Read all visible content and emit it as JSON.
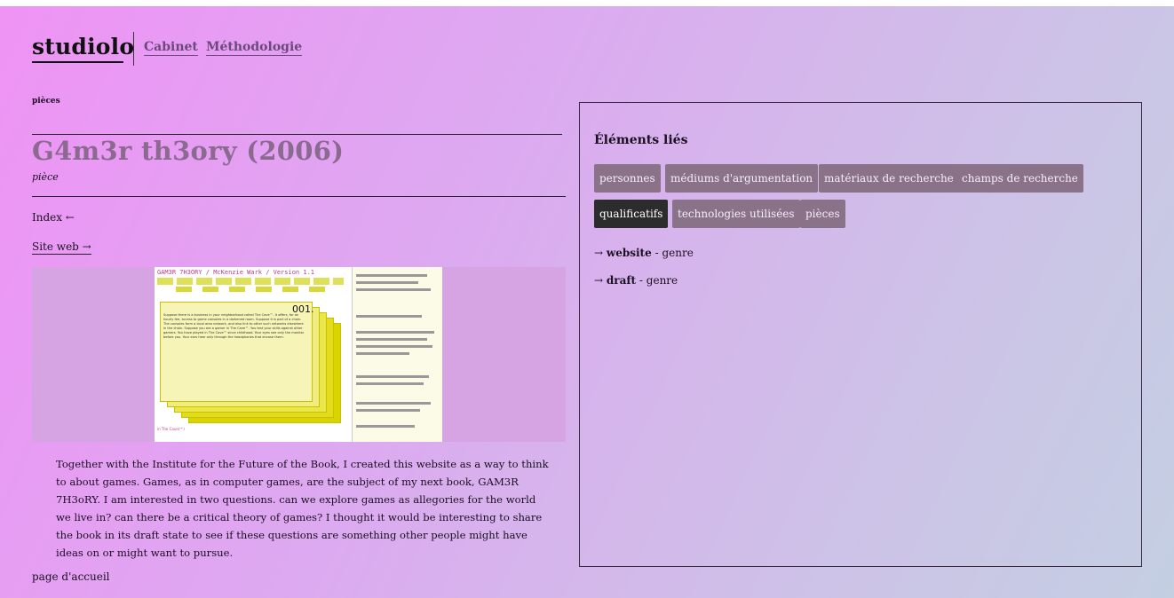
{
  "site": {
    "brand": "studiolo",
    "nav": [
      {
        "label": "Cabinet"
      },
      {
        "label": "Méthodologie"
      }
    ]
  },
  "page": {
    "breadcrumb": "pièces",
    "title": "G4m3r th3ory (2006)",
    "subtitle": "pièce",
    "index_link": "Index ←",
    "site_link": "Site web →",
    "description": "Together with the Institute for the Future of the Book, I created this website as a way to think to about games. Games, as in computer games, are the subject of my next book, GAM3R 7H3oRY. I am interested in two questions. can we explore games as allegories for the world we live in? can there be a critical theory of games? I thought it would be interesting to share the book in its draft state to see if these questions are something other people might have ideas on or might want to pursue.",
    "footer_link": "page d'accueil"
  },
  "screenshot": {
    "title": "GAM3R 7H3ORY / McKenzie Wark / Version 1.1",
    "card_number": "001.",
    "card_text": "Suppose there is a business in your neighborhood called The Cave™. It offers, for an hourly fee, access to game consoles in a darkened room. Suppose it is part of a chain. The consoles form a local area network, and also link to other such networks elsewhere in the chain. Suppose you are a gamer in The Cave™. You test your skills against other gamers. You have played in The Cave™ since childhood. Your eyes see only the monitor before you. Your ears hear only through the headphones that encase them.",
    "footer": "in The Cave(™)"
  },
  "panel": {
    "title": "Éléments liés",
    "tags": [
      {
        "label": "personnes",
        "active": false
      },
      {
        "label": "médiums d'argumentation",
        "active": false
      },
      {
        "label": "matériaux de recherche",
        "active": false
      },
      {
        "label": "champs de recherche",
        "active": false
      },
      {
        "label": "qualificatifs",
        "active": true
      },
      {
        "label": "technologies utilisées",
        "active": false
      },
      {
        "label": "pièces",
        "active": false
      }
    ],
    "relations": [
      {
        "arrow": "→",
        "name": "website",
        "type": "- genre"
      },
      {
        "arrow": "→",
        "name": "draft",
        "type": "- genre"
      }
    ]
  }
}
